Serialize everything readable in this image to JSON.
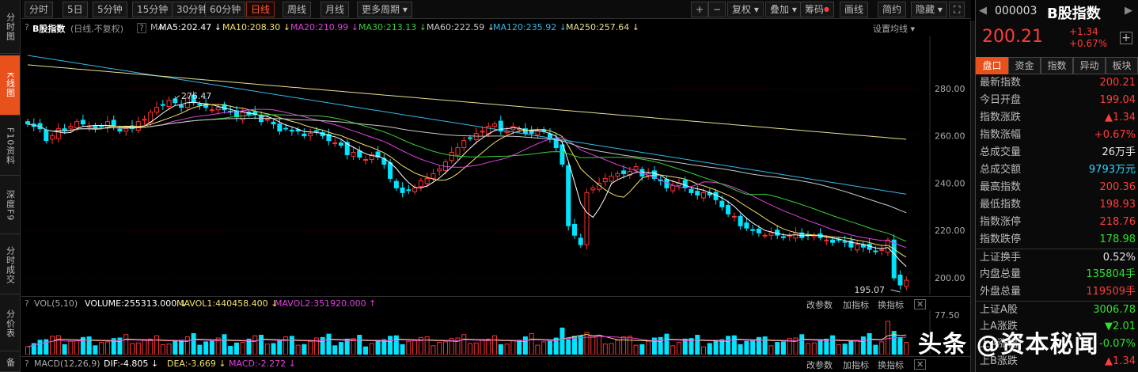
{
  "left_nav": [
    {
      "label": "分时图",
      "active": false
    },
    {
      "label": "K线图",
      "active": true
    },
    {
      "label": "F10资料",
      "active": false
    },
    {
      "label": "深度F9",
      "active": false
    },
    {
      "label": "分时成交",
      "active": false
    },
    {
      "label": "分价表",
      "active": false
    },
    {
      "label": "备",
      "active": false
    }
  ],
  "toolbar": {
    "periods": [
      "分时",
      "5日",
      "5分钟",
      "15分钟",
      "30分钟",
      "60分钟",
      "日线",
      "周线",
      "月线",
      "更多周期"
    ],
    "active_period": "日线",
    "tools": [
      "+",
      "−",
      "复权",
      "叠加",
      "筹码",
      "画线",
      "简约",
      "隐藏"
    ]
  },
  "info": {
    "name": "B股指数",
    "mode": "(日线,不复权)",
    "ma_label": "MA",
    "ma": [
      {
        "text": "MA5:202.47",
        "color": "#ffffff"
      },
      {
        "text": "MA10:208.30",
        "color": "#f5e16b"
      },
      {
        "text": "MA20:210.99",
        "color": "#e040e0"
      },
      {
        "text": "MA30:213.13",
        "color": "#38d038"
      },
      {
        "text": "MA60:222.59",
        "color": "#c8c8c8"
      },
      {
        "text": "MA120:235.92",
        "color": "#30b8e8"
      },
      {
        "text": "MA250:257.64",
        "color": "#e8e090"
      }
    ],
    "settings": "设置均线"
  },
  "chart_data": {
    "type": "candlestick",
    "y_ticks": [
      "280.00",
      "260.00",
      "240.00",
      "220.00",
      "200.00"
    ],
    "ylim": [
      193,
      302
    ],
    "high_label": "276.47",
    "low_label": "195.07",
    "up_color": "#ff3232",
    "down_color": "#00e4ff",
    "closes": [
      265,
      264,
      263,
      258,
      260,
      263,
      262,
      264,
      266,
      265,
      264,
      263,
      264,
      266,
      264,
      262,
      263,
      263,
      266,
      267,
      270,
      272,
      273,
      275,
      274,
      272,
      276,
      274,
      273,
      272,
      271,
      272,
      271,
      270,
      268,
      270,
      269,
      269,
      266,
      267,
      265,
      262,
      263,
      262,
      262,
      260,
      261,
      262,
      260,
      258,
      257,
      256,
      252,
      253,
      251,
      250,
      252,
      251,
      248,
      242,
      238,
      236,
      237,
      238,
      241,
      242,
      244,
      246,
      249,
      253,
      255,
      258,
      259,
      261,
      262,
      264,
      265,
      262,
      262,
      264,
      263,
      261,
      261,
      262,
      262,
      259,
      255,
      248,
      222,
      218,
      214,
      236,
      238,
      240,
      242,
      243,
      244,
      244,
      245,
      247,
      243,
      244,
      242,
      241,
      238,
      239,
      240,
      238,
      236,
      235,
      236,
      235,
      233,
      230,
      227,
      226,
      222,
      221,
      220,
      219,
      218,
      219,
      218,
      217,
      218,
      219,
      217,
      218,
      218,
      217,
      216,
      215,
      216,
      215,
      213,
      214,
      213,
      212,
      211,
      212,
      216,
      200,
      197,
      199
    ],
    "volume": {
      "ylim": [
        0,
        80
      ],
      "tick": "77.50"
    }
  },
  "vol_info": {
    "label": "VOL(5,10)",
    "items": [
      {
        "text": "VOLUME:255313.000",
        "color": "#ffffff"
      },
      {
        "text": "MAVOL1:440458.400",
        "color": "#f5e16b"
      },
      {
        "text": "MAVOL2:351920.000",
        "color": "#e040e0"
      }
    ],
    "actions": [
      "改参数",
      "加指标",
      "换指标"
    ]
  },
  "macd_info": {
    "label": "MACD(12,26,9)",
    "items": [
      {
        "text": "DIF:-4.805",
        "color": "#ffffff"
      },
      {
        "text": "DEA:-3.669",
        "color": "#f5e16b"
      },
      {
        "text": "MACD:-2.272",
        "color": "#e040e0"
      }
    ],
    "actions": [
      "改参数",
      "加指标",
      "换指标"
    ]
  },
  "quote": {
    "code": "000003",
    "name": "B股指数",
    "price": "200.21",
    "change": "+1.34",
    "pct": "+0.67%"
  },
  "tabs": [
    "盘口",
    "资金",
    "指数",
    "异动",
    "板块"
  ],
  "stats": [
    {
      "k": "最新指数",
      "v": "200.21",
      "c": "#ff3c3c"
    },
    {
      "k": "今日开盘",
      "v": "199.04",
      "c": "#ff3c3c"
    },
    {
      "k": "指数涨跌",
      "v": "▲1.34",
      "c": "#ff3c3c"
    },
    {
      "k": "指数涨幅",
      "v": "+0.67%",
      "c": "#ff3c3c"
    },
    {
      "k": "总成交量",
      "v": "26万手",
      "c": "#e8e8e8"
    },
    {
      "k": "总成交额",
      "v": "9793万元",
      "c": "#30d8ff"
    },
    {
      "k": "最高指数",
      "v": "200.36",
      "c": "#ff3c3c"
    },
    {
      "k": "最低指数",
      "v": "198.93",
      "c": "#ff3c3c"
    },
    {
      "k": "指数涨停",
      "v": "218.76",
      "c": "#ff3c3c"
    },
    {
      "k": "指数跌停",
      "v": "178.98",
      "c": "#30e030"
    },
    {
      "k": "上证换手",
      "v": "0.52%",
      "c": "#e8e8e8"
    },
    {
      "k": "内盘总量",
      "v": "135804手",
      "c": "#30e030"
    },
    {
      "k": "外盘总量",
      "v": "119509手",
      "c": "#ff3c3c"
    },
    {
      "k": "上证A股",
      "v": "3006.78",
      "c": "#30e030"
    },
    {
      "k": "上A涨跌",
      "v": "▼2.01",
      "c": "#30e030"
    },
    {
      "k": "上A涨幅",
      "v": "-0.07%",
      "c": "#30e030"
    },
    {
      "k": "上B涨跌",
      "v": "▲1.34",
      "c": "#ff3c3c"
    }
  ],
  "watermark": "头条 @资本秘闻"
}
